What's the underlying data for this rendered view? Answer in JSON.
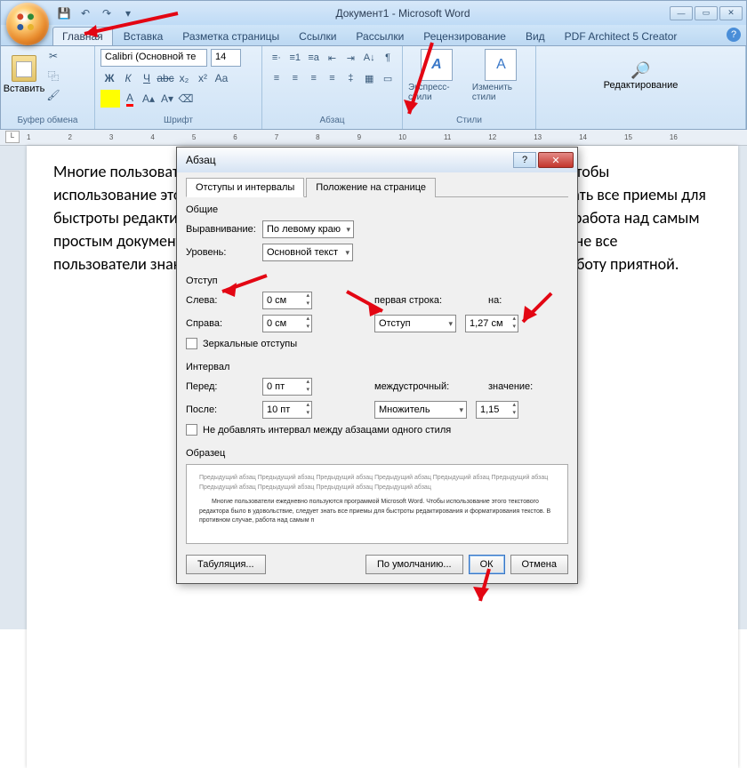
{
  "title": "Документ1 - Microsoft Word",
  "tabs": [
    "Главная",
    "Вставка",
    "Разметка страницы",
    "Ссылки",
    "Рассылки",
    "Рецензирование",
    "Вид",
    "PDF Architect 5 Creator"
  ],
  "ribbon": {
    "clipboard": {
      "label": "Буфер обмена",
      "paste": "Вставить"
    },
    "font": {
      "label": "Шрифт",
      "name": "Calibri (Основной те",
      "size": "14"
    },
    "paragraph": {
      "label": "Абзац"
    },
    "styles": {
      "label": "Стили",
      "express": "Экспресс-стили",
      "change": "Изменить стили"
    },
    "editing": {
      "label": "Редактирование"
    }
  },
  "ruler_ticks": [
    "1",
    "2",
    "3",
    "4",
    "5",
    "6",
    "7",
    "8",
    "9",
    "10",
    "11",
    "12",
    "13",
    "14",
    "15",
    "16"
  ],
  "doc_text": "Многие пользователи ежедневно пользуются программой Microsoft Word. Чтобы использование этого текстового редактора было в удовольствие, следует знать все приемы для быстроты редактирования и форматирования текстов. В противном случае, работа над самым простым документом может стать  очень сложным и долгим занятием, ведь не все пользователи знакомы с фишками Word, которые сделают повседневную работу приятной.",
  "dialog": {
    "title": "Абзац",
    "tabs": [
      "Отступы и интервалы",
      "Положение на странице"
    ],
    "general": {
      "label": "Общие",
      "align_label": "Выравнивание:",
      "align_value": "По левому краю",
      "level_label": "Уровень:",
      "level_value": "Основной текст"
    },
    "indent": {
      "label": "Отступ",
      "left_label": "Слева:",
      "left_value": "0 см",
      "right_label": "Справа:",
      "right_value": "0 см",
      "first_label": "первая строка:",
      "first_value": "Отступ",
      "by_label": "на:",
      "by_value": "1,27 см",
      "mirror": "Зеркальные отступы"
    },
    "spacing": {
      "label": "Интервал",
      "before_label": "Перед:",
      "before_value": "0 пт",
      "after_label": "После:",
      "after_value": "10 пт",
      "line_label": "междустрочный:",
      "line_value": "Множитель",
      "at_label": "значение:",
      "at_value": "1,15",
      "nospace": "Не добавлять интервал между абзацами одного стиля"
    },
    "preview_label": "Образец",
    "preview_filler": "Предыдущий абзац Предыдущий абзац Предыдущий абзац Предыдущий абзац Предыдущий абзац Предыдущий абзац Предыдущий абзац Предыдущий абзац Предыдущий абзац Предыдущий абзац",
    "preview_sample": "Многие пользователи ежедневно пользуются программой Microsoft Word. Чтобы использование этого текстового редактора было в удовольствие, следует знать все приемы для быстроты редактирования и форматирования текстов. В противном случае, работа над самым п",
    "buttons": {
      "tabs": "Табуляция...",
      "default": "По умолчанию...",
      "ok": "ОК",
      "cancel": "Отмена"
    }
  }
}
